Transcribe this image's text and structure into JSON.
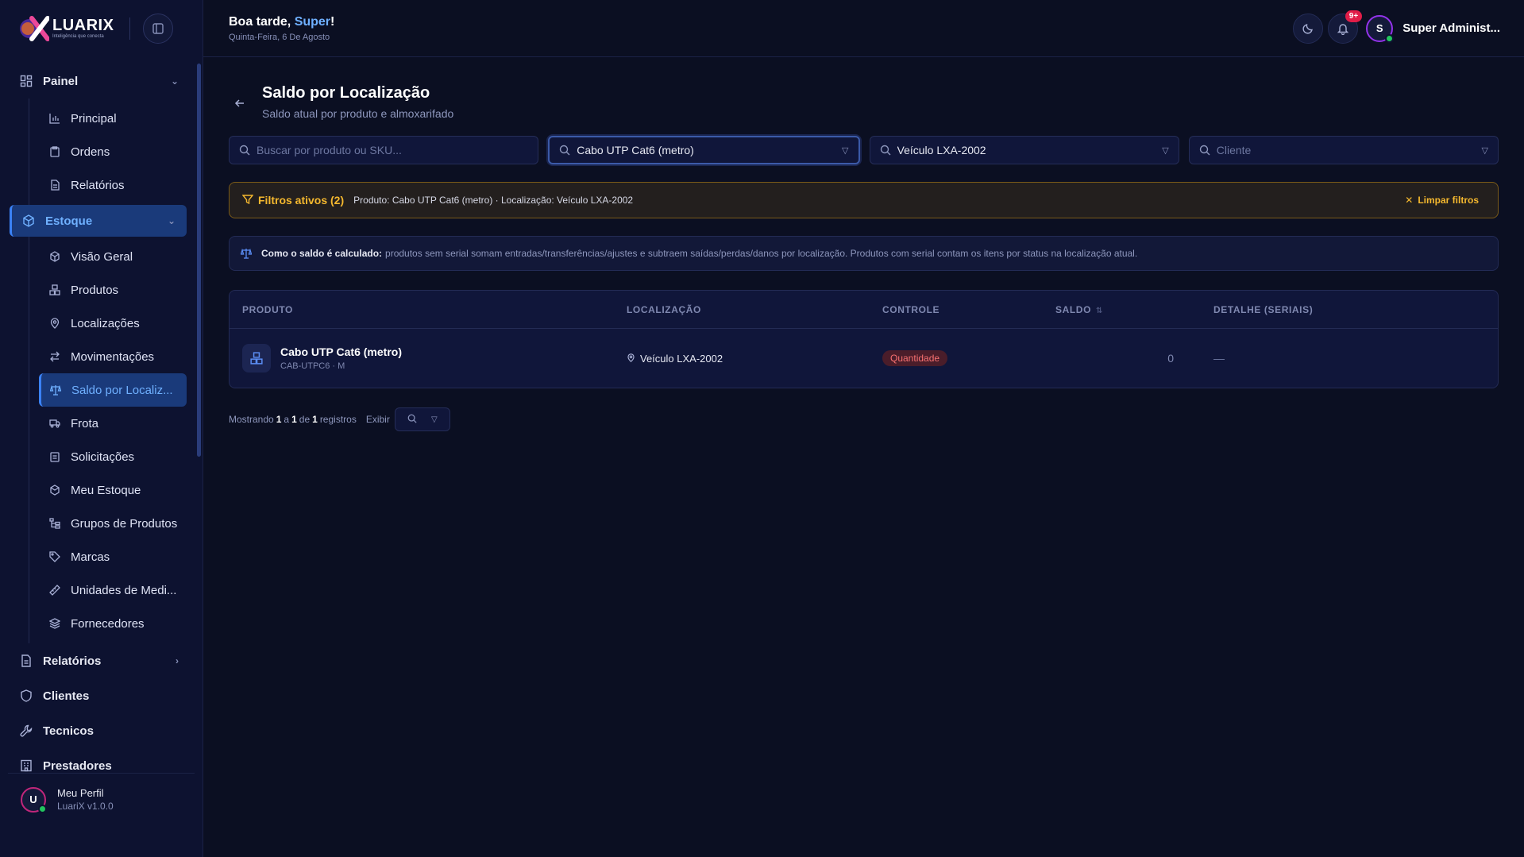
{
  "brand": {
    "name": "LUARIX",
    "tagline": "Inteligência que conecta"
  },
  "sidebar": {
    "groups": [
      {
        "label": "Painel",
        "icon": "dashboard-icon",
        "expanded": true
      },
      {
        "label": "Estoque",
        "icon": "box-icon",
        "expanded": true,
        "active": true
      },
      {
        "label": "Relatórios",
        "icon": "report-icon",
        "expanded": false
      },
      {
        "label": "Clientes",
        "icon": "shield-icon"
      },
      {
        "label": "Tecnicos",
        "icon": "wrench-icon"
      },
      {
        "label": "Prestadores",
        "icon": "building-icon"
      }
    ],
    "painel_items": [
      "Principal",
      "Ordens",
      "Relatórios"
    ],
    "estoque_items": [
      "Visão Geral",
      "Produtos",
      "Localizações",
      "Movimentações",
      "Saldo por Localiz...",
      "Frota",
      "Solicitações",
      "Meu Estoque",
      "Grupos de Produtos",
      "Marcas",
      "Unidades de Medi...",
      "Fornecedores"
    ],
    "footer": {
      "avatar_letter": "U",
      "name": "Meu Perfil",
      "version": "LuariX v1.0.0"
    }
  },
  "topbar": {
    "greeting_prefix": "Boa tarde, ",
    "greeting_name": "Super",
    "greeting_suffix": "!",
    "date": "Quinta-Feira, 6 De Agosto",
    "notifications_badge": "9+",
    "user_avatar_letter": "S",
    "user_name": "Super Administ..."
  },
  "page": {
    "title": "Saldo por Localização",
    "subtitle": "Saldo atual por produto e almoxarifado"
  },
  "filters": {
    "search_placeholder": "Buscar por produto ou SKU...",
    "product_value": "Cabo UTP Cat6 (metro)",
    "location_value": "Veículo LXA-2002",
    "client_placeholder": "Cliente"
  },
  "active_filters": {
    "title": "Filtros ativos (2)",
    "description": "Produto: Cabo UTP Cat6 (metro) · Localização: Veículo LXA-2002",
    "clear_label": "Limpar filtros"
  },
  "info": {
    "label": "Como o saldo é calculado:",
    "text": "produtos sem serial somam entradas/transferências/ajustes e subtraem saídas/perdas/danos por localização. Produtos com serial contam os itens por status na localização atual."
  },
  "table": {
    "headers": [
      "PRODUTO",
      "LOCALIZAÇÃO",
      "CONTROLE",
      "SALDO",
      "DETALHE (SERIAIS)"
    ],
    "rows": [
      {
        "product": "Cabo UTP Cat6 (metro)",
        "sku": "CAB-UTPC6 · M",
        "location": "Veículo LXA-2002",
        "control": "Quantidade",
        "saldo": "0",
        "detail": "—"
      }
    ]
  },
  "pager": {
    "prefix": "Mostrando",
    "from": "1",
    "sep1": "a",
    "to": "1",
    "sep2": "de",
    "total": "1",
    "suffix": "registros",
    "show_label": "Exibir"
  },
  "colors": {
    "background": "#0b0f22",
    "accent": "#3b82f6",
    "warning": "#f5b82e",
    "danger": "#f87171"
  }
}
